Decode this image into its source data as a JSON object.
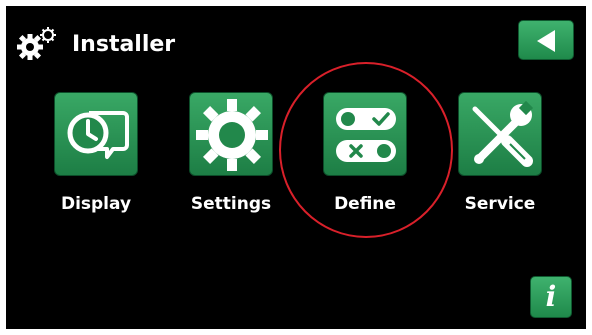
{
  "header": {
    "icon": "gears-icon",
    "title": "Installer"
  },
  "nav": {
    "back_icon": "back-arrow-icon"
  },
  "menu": {
    "items": [
      {
        "label": "Display",
        "icon": "display-clock-icon"
      },
      {
        "label": "Settings",
        "icon": "gear-icon"
      },
      {
        "label": "Define",
        "icon": "toggle-switches-icon"
      },
      {
        "label": "Service",
        "icon": "wrench-screwdriver-icon"
      }
    ]
  },
  "footer": {
    "info_label": "i",
    "info_icon": "info-icon"
  },
  "colors": {
    "background": "#000000",
    "tile_green": "#2a9654",
    "annotation_red": "#d9202a",
    "text": "#ffffff"
  }
}
